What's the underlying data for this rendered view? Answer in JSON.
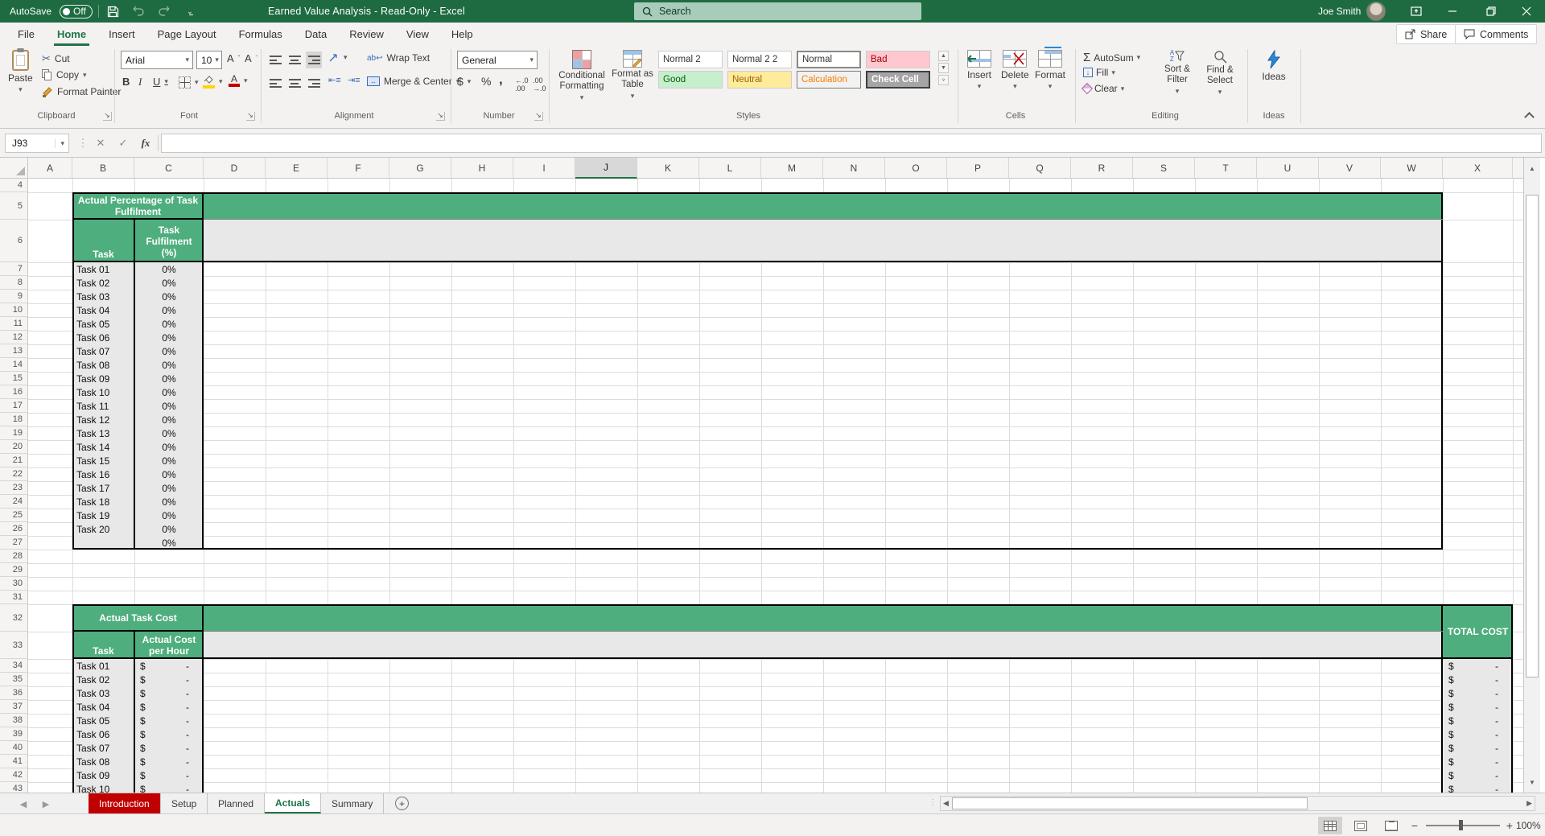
{
  "colors": {
    "title_green": "#1e6b41",
    "accent_green": "#217346",
    "table_green": "#4fae7e",
    "tab_red": "#c00000",
    "bad_pink": "#ffc7ce",
    "good_green": "#c6efce",
    "neutral_yellow": "#ffeb9c",
    "check_gray": "#a5a5a5"
  },
  "titlebar": {
    "autosave_label": "AutoSave",
    "autosave_state": "Off",
    "title": "Earned Value Analysis - Read-Only - Excel",
    "search_placeholder": "Search",
    "user_name": "Joe Smith"
  },
  "ribbon_tabs": {
    "items": [
      "File",
      "Home",
      "Insert",
      "Page Layout",
      "Formulas",
      "Data",
      "Review",
      "View",
      "Help"
    ],
    "active": "Home",
    "share_label": "Share",
    "comments_label": "Comments"
  },
  "ribbon": {
    "clipboard": {
      "label": "Clipboard",
      "paste": "Paste",
      "cut": "Cut",
      "copy": "Copy",
      "format_painter": "Format Painter"
    },
    "font": {
      "label": "Font",
      "family": "Arial",
      "size": "10",
      "bold": "B",
      "italic": "I",
      "underline": "U"
    },
    "alignment": {
      "label": "Alignment",
      "wrap_text": "Wrap Text",
      "merge_center": "Merge & Center"
    },
    "number": {
      "label": "Number",
      "format": "General",
      "currency": "$",
      "percent": "%",
      "comma": ",",
      "inc_dec": ".00",
      "dec_dec": ".00"
    },
    "styles": {
      "label": "Styles",
      "conditional": "Conditional Formatting",
      "format_table": "Format as Table",
      "gallery": [
        [
          "Normal 2",
          "Normal 2 2",
          "Normal",
          "Bad"
        ],
        [
          "Good",
          "Neutral",
          "Calculation",
          "Check Cell"
        ]
      ]
    },
    "cells": {
      "label": "Cells",
      "insert": "Insert",
      "delete": "Delete",
      "format": "Format"
    },
    "editing": {
      "label": "Editing",
      "autosum": "AutoSum",
      "fill": "Fill",
      "clear": "Clear",
      "sort": "Sort & Filter",
      "find": "Find & Select"
    },
    "ideas": {
      "label": "Ideas",
      "button": "Ideas"
    }
  },
  "formula_bar": {
    "name_box": "J93",
    "fx_label": "fx",
    "formula": ""
  },
  "sheet": {
    "columns": [
      "A",
      "B",
      "C",
      "D",
      "E",
      "F",
      "G",
      "H",
      "I",
      "J",
      "K",
      "L",
      "M",
      "N",
      "O",
      "P",
      "Q",
      "R",
      "S",
      "T",
      "U",
      "V",
      "W",
      "X"
    ],
    "selected_column": "J",
    "row_numbers": [
      4,
      5,
      6,
      7,
      8,
      9,
      10,
      11,
      12,
      13,
      14,
      15,
      16,
      17,
      18,
      19,
      20,
      21,
      22,
      23,
      24,
      25,
      26,
      27,
      28,
      29,
      30,
      31,
      32,
      33,
      34,
      35,
      36,
      37,
      38,
      39,
      40,
      41,
      42,
      43
    ],
    "fulfilment_table": {
      "title": "Actual Percentage of Task Fulfilment",
      "task_header": "Task",
      "value_header": "Task Fulfilment (%)",
      "rows": [
        {
          "task": "Task 01",
          "value": "0%"
        },
        {
          "task": "Task 02",
          "value": "0%"
        },
        {
          "task": "Task 03",
          "value": "0%"
        },
        {
          "task": "Task 04",
          "value": "0%"
        },
        {
          "task": "Task 05",
          "value": "0%"
        },
        {
          "task": "Task 06",
          "value": "0%"
        },
        {
          "task": "Task 07",
          "value": "0%"
        },
        {
          "task": "Task 08",
          "value": "0%"
        },
        {
          "task": "Task 09",
          "value": "0%"
        },
        {
          "task": "Task 10",
          "value": "0%"
        },
        {
          "task": "Task 11",
          "value": "0%"
        },
        {
          "task": "Task 12",
          "value": "0%"
        },
        {
          "task": "Task 13",
          "value": "0%"
        },
        {
          "task": "Task 14",
          "value": "0%"
        },
        {
          "task": "Task 15",
          "value": "0%"
        },
        {
          "task": "Task 16",
          "value": "0%"
        },
        {
          "task": "Task 17",
          "value": "0%"
        },
        {
          "task": "Task 18",
          "value": "0%"
        },
        {
          "task": "Task 19",
          "value": "0%"
        },
        {
          "task": "Task 20",
          "value": "0%"
        },
        {
          "task": "",
          "value": "0%"
        }
      ]
    },
    "cost_table": {
      "title": "Actual Task Cost",
      "task_header": "Task",
      "value_header": "Actual Cost per Hour",
      "total_header": "TOTAL COST",
      "currency": "$",
      "amount": "-",
      "tasks": [
        "Task 01",
        "Task 02",
        "Task 03",
        "Task 04",
        "Task 05",
        "Task 06",
        "Task 07",
        "Task 08",
        "Task 09",
        "Task 10"
      ]
    }
  },
  "sheet_tabs": {
    "items": [
      {
        "label": "Introduction",
        "color": "red"
      },
      {
        "label": "Setup"
      },
      {
        "label": "Planned"
      },
      {
        "label": "Actuals",
        "active": true
      },
      {
        "label": "Summary"
      }
    ]
  },
  "status_bar": {
    "zoom_level": "100%"
  }
}
